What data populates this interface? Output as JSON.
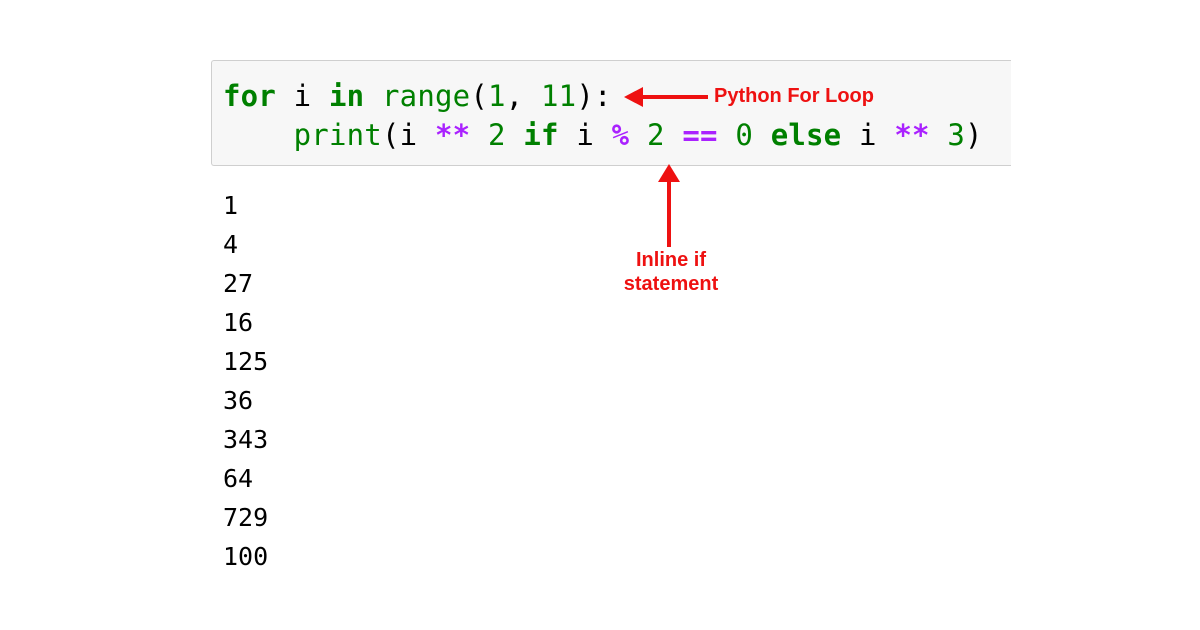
{
  "code_cell": {
    "line1": {
      "indent": "",
      "tokens": [
        "for",
        " ",
        "i",
        " ",
        "in",
        " ",
        "range",
        "(",
        "1",
        ", ",
        "11",
        "):"
      ]
    },
    "line2": {
      "indent": "    ",
      "tokens": [
        "print",
        "(",
        "i",
        " ",
        "**",
        " ",
        "2",
        " ",
        "if",
        " ",
        "i",
        " ",
        "%",
        " ",
        "2",
        " ",
        "==",
        " ",
        "0",
        " ",
        "else",
        " ",
        "i",
        " ",
        "**",
        " ",
        "3",
        ")"
      ]
    }
  },
  "output": {
    "lines": [
      "1",
      "4",
      "27",
      "16",
      "125",
      "36",
      "343",
      "64",
      "729",
      "100"
    ]
  },
  "annotations": {
    "for_loop": "Python For Loop",
    "inline_if_line1": "Inline if",
    "inline_if_line2": "statement"
  },
  "colors": {
    "annotation": "#ee1111",
    "keyword": "#008000",
    "operator": "#aa22ff",
    "cell_background": "#f7f7f7"
  }
}
